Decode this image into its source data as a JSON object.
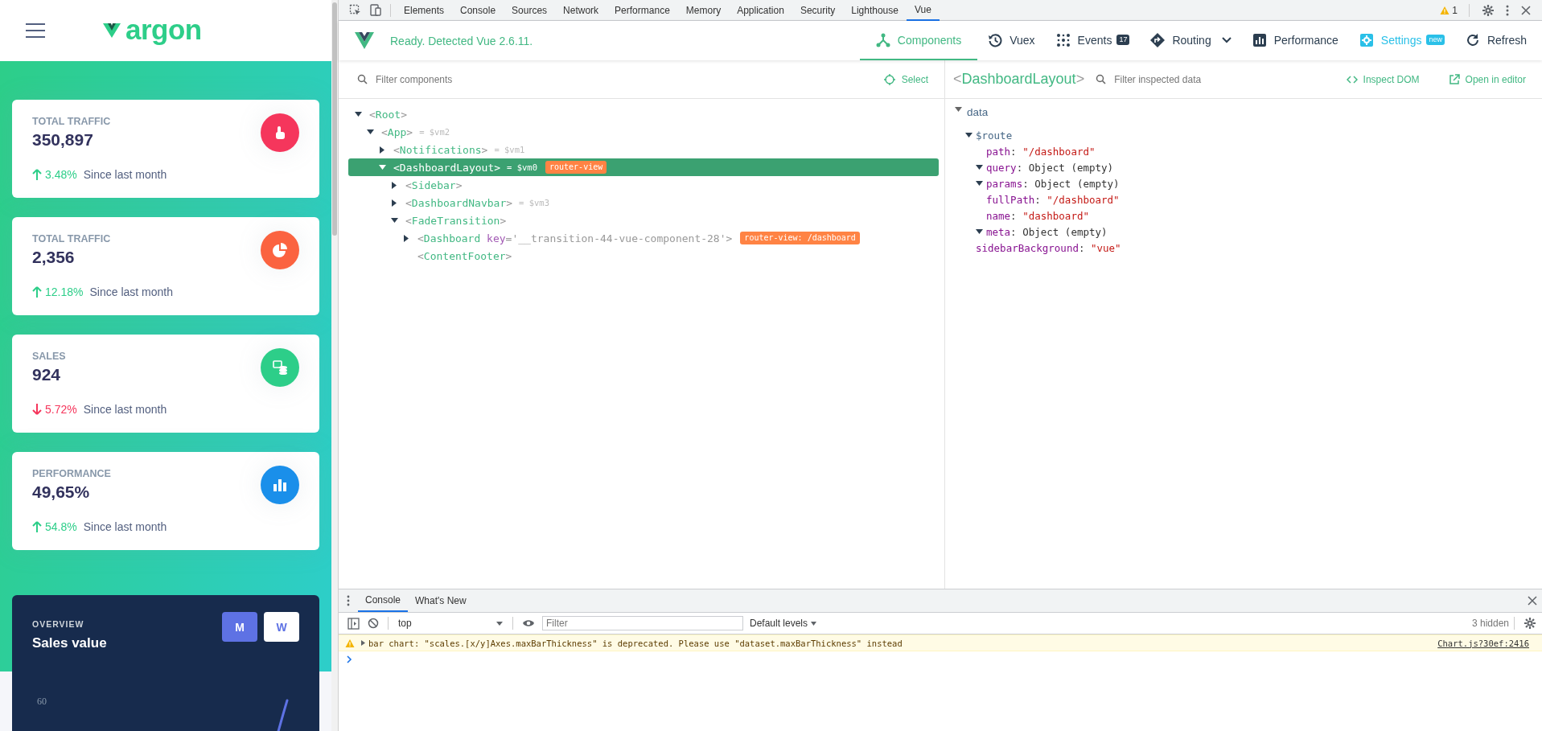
{
  "app": {
    "header": {
      "logo": "argon"
    },
    "stats": [
      {
        "label": "TOTAL TRAFFIC",
        "value": "350,897",
        "trend": {
          "kind": "up",
          "percent": "3.48%"
        },
        "caption": "Since last month",
        "kind": "pointer",
        "color": "#f5365c"
      },
      {
        "label": "TOTAL TRAFFIC",
        "value": "2,356",
        "trend": {
          "kind": "up",
          "percent": "12.18%"
        },
        "caption": "Since last month",
        "kind": "pie",
        "color": "#fb6340"
      },
      {
        "label": "SALES",
        "value": "924",
        "trend": {
          "kind": "down",
          "percent": "5.72%"
        },
        "caption": "Since last month",
        "kind": "coins",
        "color": "#2dce89"
      },
      {
        "label": "PERFORMANCE",
        "value": "49,65%",
        "trend": {
          "kind": "up",
          "percent": "54.8%"
        },
        "caption": "Since last month",
        "kind": "bars",
        "color": "#1a8fea"
      }
    ],
    "overview": {
      "eyebrow": "OVERVIEW",
      "title": "Sales value",
      "buttons": [
        {
          "label": "M",
          "selected": true
        },
        {
          "label": "W",
          "selected": false
        }
      ],
      "y_tick": "60"
    }
  },
  "devtools": {
    "tabs": [
      {
        "label": "Elements",
        "selected": false
      },
      {
        "label": "Console",
        "selected": false
      },
      {
        "label": "Sources",
        "selected": false
      },
      {
        "label": "Network",
        "selected": false
      },
      {
        "label": "Performance",
        "selected": false
      },
      {
        "label": "Memory",
        "selected": false
      },
      {
        "label": "Application",
        "selected": false
      },
      {
        "label": "Security",
        "selected": false
      },
      {
        "label": "Lighthouse",
        "selected": false
      },
      {
        "label": "Vue",
        "selected": true
      }
    ],
    "warning_count": "1",
    "vue": {
      "status": "Ready. Detected Vue 2.6.11.",
      "nav": [
        {
          "label": "Components",
          "kind": "components",
          "selected": true,
          "accent": false,
          "dropdown": false
        },
        {
          "label": "Vuex",
          "kind": "history",
          "selected": false,
          "accent": false,
          "dropdown": false
        },
        {
          "label": "Events",
          "kind": "dots",
          "badge": "17",
          "selected": false,
          "accent": false,
          "dropdown": false
        },
        {
          "label": "Routing",
          "kind": "diamond",
          "selected": false,
          "accent": false,
          "dropdown": true
        },
        {
          "label": "Performance",
          "kind": "chart",
          "selected": false,
          "accent": false,
          "dropdown": false
        },
        {
          "label": "Settings",
          "kind": "gear",
          "badge": "new",
          "selected": false,
          "accent": true,
          "dropdown": false
        },
        {
          "label": "Refresh",
          "kind": "refresh",
          "selected": false,
          "accent": false,
          "dropdown": false
        }
      ]
    },
    "components": {
      "filter_placeholder": "Filter components",
      "select_label": "Select",
      "bracket_open": "<",
      "bracket_close": ">",
      "assign": "=",
      "tree": [
        {
          "name": "Root",
          "kind": "branch",
          "expanded": true,
          "selected": false,
          "children": [
            {
              "name": "App",
              "ref": "$vm2",
              "kind": "branch",
              "expanded": true,
              "selected": false,
              "children": [
                {
                  "name": "Notifications",
                  "ref": "$vm1",
                  "kind": "branch",
                  "expanded": false,
                  "selected": false
                },
                {
                  "name": "DashboardLayout",
                  "ref": "$vm0",
                  "badge": "router-view",
                  "kind": "branch",
                  "expanded": true,
                  "selected": true,
                  "children": [
                    {
                      "name": "Sidebar",
                      "kind": "branch",
                      "expanded": false,
                      "selected": false
                    },
                    {
                      "name": "DashboardNavbar",
                      "ref": "$vm3",
                      "kind": "branch",
                      "expanded": false,
                      "selected": false
                    },
                    {
                      "name": "FadeTransition",
                      "kind": "branch",
                      "expanded": true,
                      "selected": false,
                      "children": [
                        {
                          "name": "Dashboard",
                          "attribute": {
                            "name": "key",
                            "value": "'__transition-44-vue-component-28'"
                          },
                          "badge": "router-view: /dashboard",
                          "kind": "branch",
                          "expanded": false,
                          "selected": false
                        },
                        {
                          "name": "ContentFooter",
                          "kind": "leaf",
                          "selected": false
                        }
                      ]
                    }
                  ]
                }
              ]
            }
          ]
        }
      ]
    },
    "inspector": {
      "title": "DashboardLayout",
      "filter_placeholder": "Filter inspected data",
      "actions": [
        {
          "label": "Inspect DOM",
          "kind": "code"
        },
        {
          "label": "Open in editor",
          "kind": "external"
        }
      ],
      "separator": ":",
      "sections": [
        {
          "key": "data",
          "expanded": true,
          "children": [
            {
              "key": "$route",
              "kind": "object",
              "expanded": true,
              "children": [
                {
                  "key": "path",
                  "kind": "string",
                  "value": "\"/dashboard\""
                },
                {
                  "key": "query",
                  "kind": "object",
                  "expanded": true,
                  "value": "Object (empty)"
                },
                {
                  "key": "params",
                  "kind": "object",
                  "expanded": true,
                  "value": "Object (empty)"
                },
                {
                  "key": "fullPath",
                  "kind": "string",
                  "value": "\"/dashboard\""
                },
                {
                  "key": "name",
                  "kind": "string",
                  "value": "\"dashboard\""
                },
                {
                  "key": "meta",
                  "kind": "object",
                  "expanded": true,
                  "value": "Object (empty)"
                }
              ]
            },
            {
              "key": "sidebarBackground",
              "kind": "string",
              "value": "\"vue\""
            }
          ]
        }
      ]
    }
  },
  "console": {
    "tabs": [
      {
        "label": "Console",
        "selected": true
      },
      {
        "label": "What's New",
        "selected": false
      }
    ],
    "context": "top",
    "filter_placeholder": "Filter",
    "levels": "Default levels",
    "hidden": "3 hidden",
    "messages": [
      {
        "kind": "warning",
        "text": "bar chart: \"scales.[x/y]Axes.maxBarThickness\" is deprecated. Please use \"dataset.maxBarThickness\" instead",
        "source": "Chart.js?30ef:2416"
      }
    ]
  }
}
